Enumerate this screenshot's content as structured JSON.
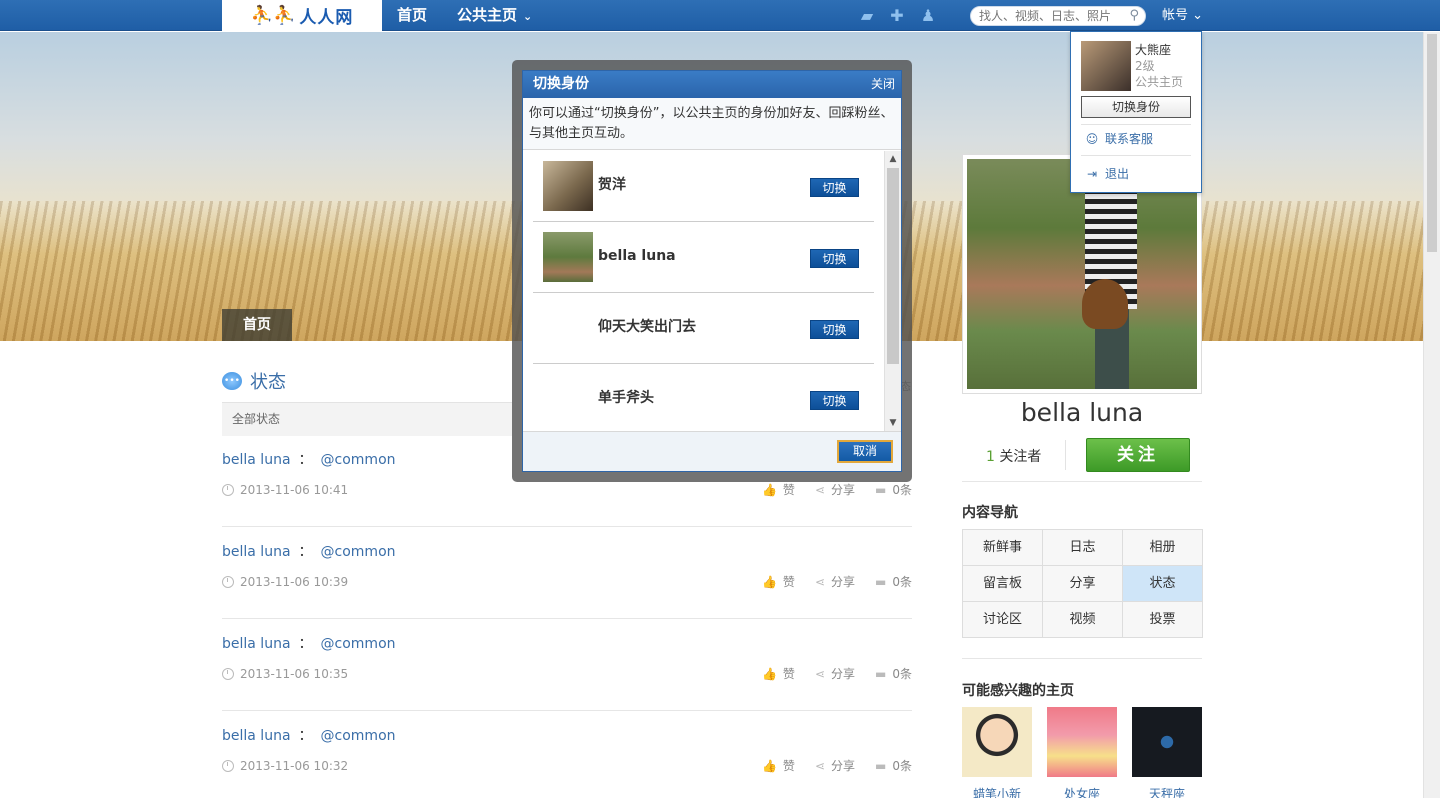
{
  "topbar": {
    "logo_text": "人人网",
    "nav_home": "首页",
    "nav_public": "公共主页",
    "search_placeholder": "找人、视频、日志、照片",
    "account_label": "帐号",
    "icons": [
      "chat-icon",
      "add-friend-icon",
      "notification-bell-icon",
      "search-icon",
      "chevron-down-icon"
    ]
  },
  "banner": {
    "tab_label": "首页"
  },
  "status": {
    "title": "状态",
    "filter_label": "全部状态",
    "filter_tail": "态",
    "items": [
      {
        "author": "bella luna",
        "separator": "：",
        "content": "@common",
        "time": "2013-11-06 10:41",
        "like": "赞",
        "share": "分享",
        "comments": "0条"
      },
      {
        "author": "bella luna",
        "separator": "：",
        "content": "@common",
        "time": "2013-11-06 10:39",
        "like": "赞",
        "share": "分享",
        "comments": "0条"
      },
      {
        "author": "bella luna",
        "separator": "：",
        "content": "@common",
        "time": "2013-11-06 10:35",
        "like": "赞",
        "share": "分享",
        "comments": "0条"
      },
      {
        "author": "bella luna",
        "separator": "：",
        "content": "@common",
        "time": "2013-11-06 10:32",
        "like": "赞",
        "share": "分享",
        "comments": "0条"
      }
    ]
  },
  "profile": {
    "name": "bella luna",
    "follower_count": "1",
    "follower_label": "关注者",
    "follow_button": "关注"
  },
  "content_nav": {
    "title": "内容导航",
    "items": [
      "新鲜事",
      "日志",
      "相册",
      "留言板",
      "分享",
      "状态",
      "讨论区",
      "视频",
      "投票"
    ],
    "active": "状态"
  },
  "interests": {
    "title": "可能感兴趣的主页",
    "items": [
      "蜡笔小新",
      "处女座",
      "天秤座"
    ]
  },
  "account_menu": {
    "user_name": "大熊座",
    "user_level": "2级",
    "user_type": "公共主页",
    "switch_button": "切换身份",
    "contact_support": "联系客服",
    "logout": "退出"
  },
  "modal": {
    "title": "切换身份",
    "close": "关闭",
    "description": "你可以通过“切换身份”，以公共主页的身份加好友、回踩粉丝、与其他主页互动。",
    "identities": [
      {
        "name": "贺洋",
        "button": "切换"
      },
      {
        "name": "bella luna",
        "button": "切换"
      },
      {
        "name": "仰天大笑出门去",
        "button": "切换"
      },
      {
        "name": "单手斧头",
        "button": "切换"
      }
    ],
    "cancel": "取消"
  },
  "colors": {
    "nav_blue": "#2a67ae",
    "link_blue": "#3a6ea8",
    "follow_green": "#4eaa32",
    "active_nav": "#cfe5f8",
    "cancel_border": "#e3a83b"
  }
}
